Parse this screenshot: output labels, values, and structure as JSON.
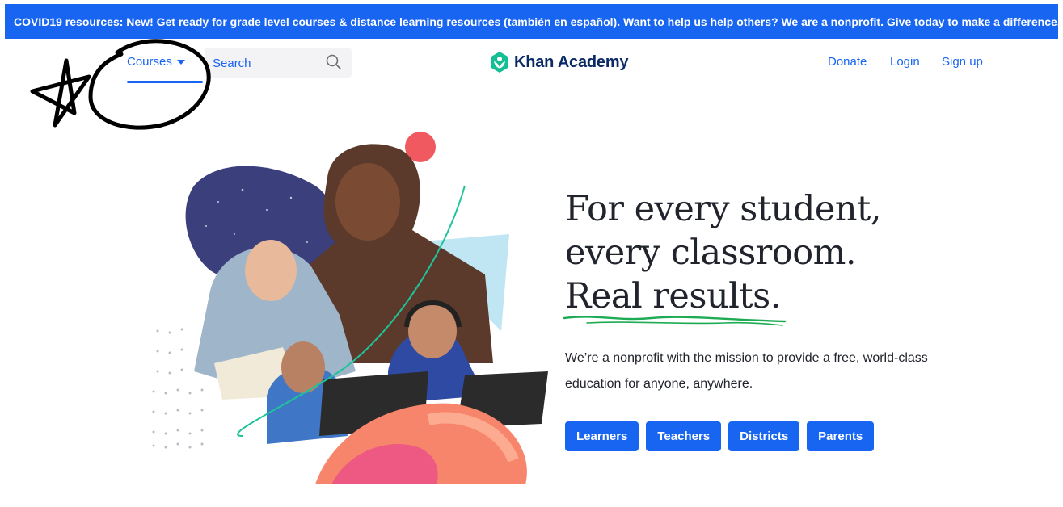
{
  "banner": {
    "prefix": "COVID19 resources: New!",
    "link1": "Get ready for grade level courses",
    "amp": "&",
    "link2": "distance learning resources",
    "mid1": "(también en",
    "link3": "español",
    "mid2": "). Want to help us help others? We are a nonprofit.",
    "link4": "Give today",
    "suffix": "to make a difference."
  },
  "nav": {
    "courses_label": "Courses",
    "search_placeholder": "Search",
    "logo_text": "Khan Academy",
    "donate": "Donate",
    "login": "Login",
    "signup": "Sign up"
  },
  "hero": {
    "title_line1": "For every student,",
    "title_line2": "every classroom.",
    "title_line3": "Real results.",
    "description": "We’re a nonprofit with the mission to provide a free, world-class education for anyone, anywhere.",
    "buttons": [
      "Learners",
      "Teachers",
      "Districts",
      "Parents"
    ]
  },
  "colors": {
    "brand_blue": "#1865f2",
    "logo_green": "#14bf96",
    "logo_navy": "#0a2a66",
    "squiggle_green": "#1fab54"
  },
  "icons": [
    "caret-down-icon",
    "search-icon",
    "khan-academy-logo-icon",
    "star-doodle",
    "circle-doodle"
  ]
}
